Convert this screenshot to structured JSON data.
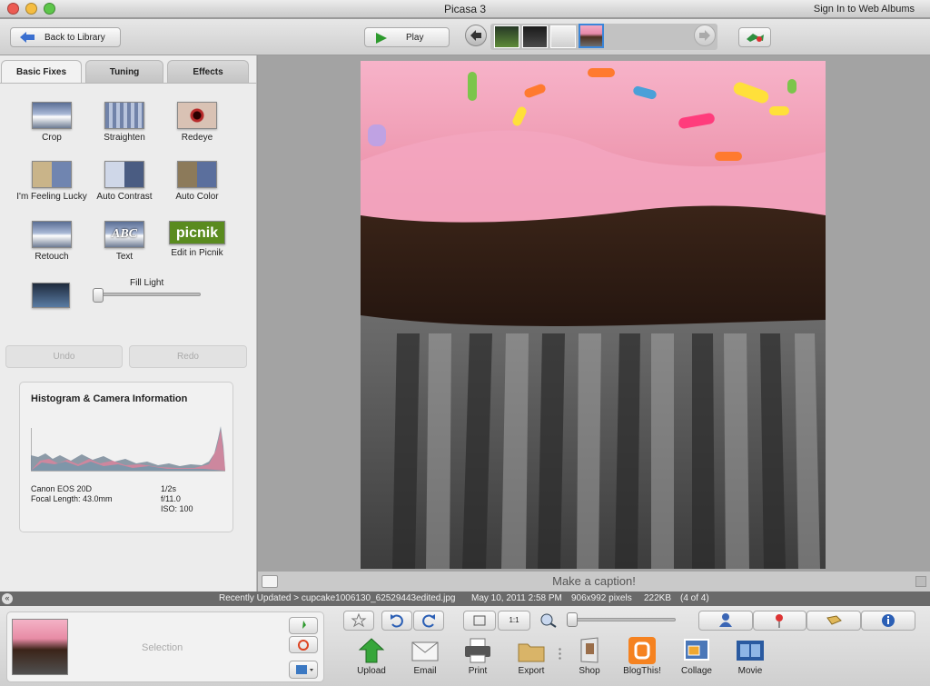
{
  "window": {
    "title": "Picasa 3",
    "sign_in": "Sign In to Web Albums"
  },
  "toolbar": {
    "back_label": "Back to Library",
    "play_label": "Play"
  },
  "tabs": [
    {
      "label": "Basic Fixes"
    },
    {
      "label": "Tuning"
    },
    {
      "label": "Effects"
    }
  ],
  "tools": [
    {
      "label": "Crop"
    },
    {
      "label": "Straighten"
    },
    {
      "label": "Redeye"
    },
    {
      "label": "I'm Feeling Lucky"
    },
    {
      "label": "Auto Contrast"
    },
    {
      "label": "Auto Color"
    },
    {
      "label": "Retouch"
    },
    {
      "label": "Text"
    },
    {
      "label": "Edit in Picnik"
    }
  ],
  "picnik_logo": "picnik",
  "text_thumb": "ABC",
  "fill_light": {
    "label": "Fill Light",
    "level": 0.0
  },
  "undo_label": "Undo",
  "redo_label": "Redo",
  "histogram": {
    "title": "Histogram & Camera Information",
    "camera": "Canon EOS 20D",
    "focal": "Focal Length: 43.0mm",
    "shutter": "1/2s",
    "aperture": "f/11.0",
    "iso": "ISO: 100"
  },
  "caption_placeholder": "Make a caption!",
  "status": {
    "path": "Recently Updated > cupcake1006130_62529443edited.jpg",
    "date": "May 10, 2011 2:58 PM",
    "dims": "906x992 pixels",
    "size": "222KB",
    "count": "(4 of 4)"
  },
  "tray": {
    "selection_label": "Selection",
    "actions": [
      {
        "label": "Upload"
      },
      {
        "label": "Email"
      },
      {
        "label": "Print"
      },
      {
        "label": "Export"
      },
      {
        "label": "Shop"
      },
      {
        "label": "BlogThis!"
      },
      {
        "label": "Collage"
      },
      {
        "label": "Movie"
      }
    ],
    "zoom_1to1": "1:1"
  }
}
